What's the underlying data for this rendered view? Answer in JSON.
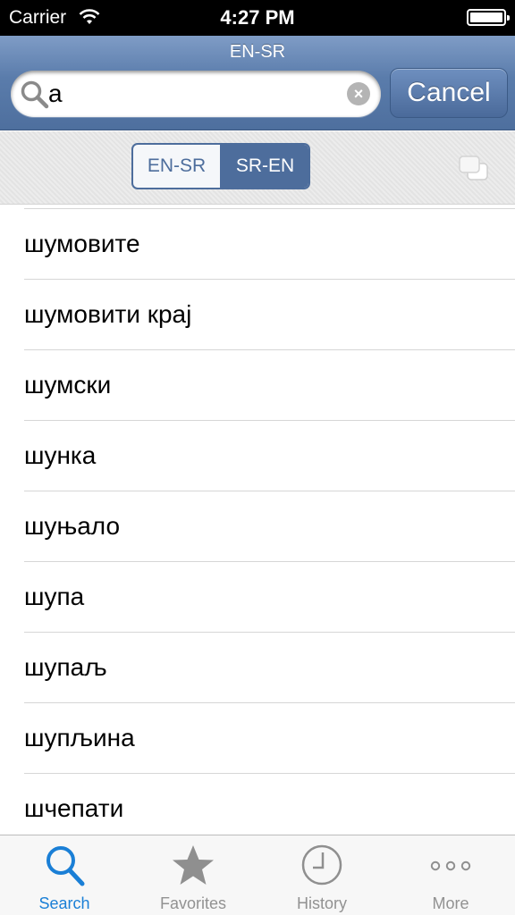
{
  "status_bar": {
    "carrier": "Carrier",
    "time": "4:27 PM"
  },
  "nav": {
    "title": "EN-SR"
  },
  "search": {
    "query": "a",
    "cancel_label": "Cancel"
  },
  "direction": {
    "options": [
      "EN-SR",
      "SR-EN"
    ],
    "selected": "SR-EN"
  },
  "results": [
    "шумовите",
    "шумовити крај",
    "шумски",
    "шунка",
    "шуњало",
    "шупа",
    "шупаљ",
    "шупљина",
    "шчепати"
  ],
  "tabs": [
    {
      "label": "Search",
      "icon": "search-icon",
      "active": true
    },
    {
      "label": "Favorites",
      "icon": "star-icon",
      "active": false
    },
    {
      "label": "History",
      "icon": "clock-icon",
      "active": false
    },
    {
      "label": "More",
      "icon": "more-dots-icon",
      "active": false
    }
  ],
  "colors": {
    "accent": "#4d6d9c",
    "tab_active": "#1a7fd6",
    "tab_inactive": "#929292"
  }
}
